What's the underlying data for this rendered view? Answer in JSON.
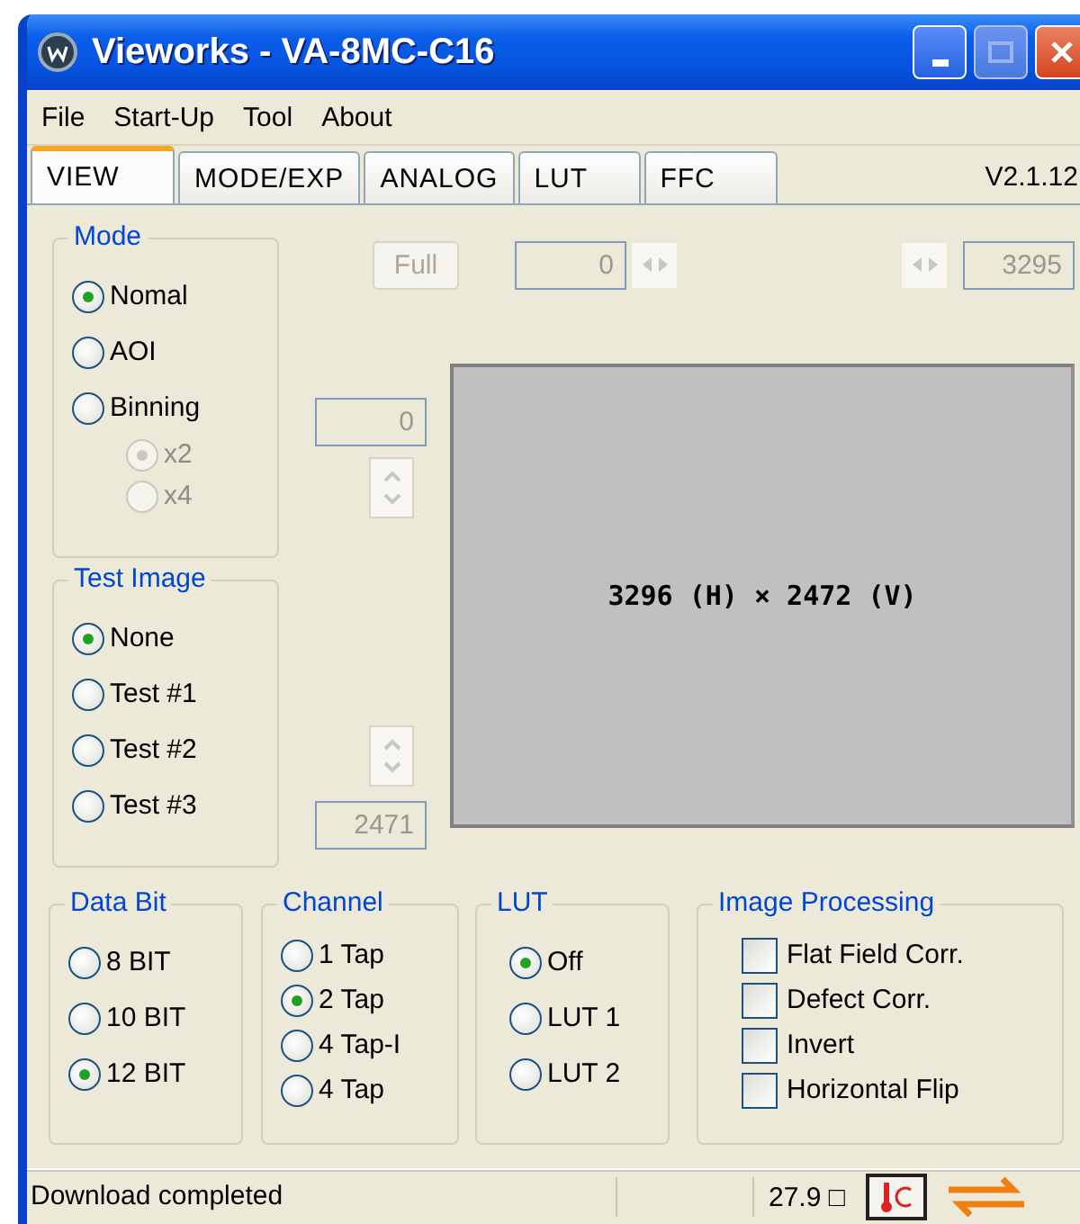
{
  "window": {
    "title": "Vieworks - VA-8MC-C16"
  },
  "menu": [
    "File",
    "Start-Up",
    "Tool",
    "About"
  ],
  "tabs": [
    {
      "label": "VIEW",
      "selected": true
    },
    {
      "label": "MODE/EXP",
      "selected": false
    },
    {
      "label": "ANALOG",
      "selected": false
    },
    {
      "label": "LUT",
      "selected": false
    },
    {
      "label": "FFC",
      "selected": false
    }
  ],
  "version": "V2.1.12",
  "mode": {
    "title": "Mode",
    "options": [
      {
        "label": "Nomal",
        "selected": true
      },
      {
        "label": "AOI",
        "selected": false
      },
      {
        "label": "Binning",
        "selected": false
      }
    ],
    "binning": {
      "disabled": true,
      "options": [
        {
          "label": "x2",
          "selected": true
        },
        {
          "label": "x4",
          "selected": false
        }
      ]
    }
  },
  "test_image": {
    "title": "Test Image",
    "options": [
      {
        "label": "None",
        "selected": true
      },
      {
        "label": "Test #1",
        "selected": false
      },
      {
        "label": "Test #2",
        "selected": false
      },
      {
        "label": "Test #3",
        "selected": false
      }
    ]
  },
  "roi": {
    "disabled": true,
    "full_button": "Full",
    "x_start": "0",
    "x_end": "3295",
    "y_start": "0",
    "y_end": "2471",
    "image_size": "3296 (H) × 2472 (V)"
  },
  "settings": [
    {
      "title": "Data Bit",
      "kind": "radio",
      "options": [
        {
          "label": "8 BIT",
          "selected": false
        },
        {
          "label": "10 BIT",
          "selected": false
        },
        {
          "label": "12 BIT",
          "selected": true
        }
      ]
    },
    {
      "title": "Channel",
      "kind": "radio",
      "options": [
        {
          "label": "1 Tap",
          "selected": false
        },
        {
          "label": "2 Tap",
          "selected": true
        },
        {
          "label": "4 Tap-I",
          "selected": false
        },
        {
          "label": "4 Tap",
          "selected": false
        }
      ]
    },
    {
      "title": "LUT",
      "kind": "radio",
      "options": [
        {
          "label": "Off",
          "selected": true
        },
        {
          "label": "LUT 1",
          "selected": false
        },
        {
          "label": "LUT 2",
          "selected": false
        }
      ]
    },
    {
      "title": "Image Processing",
      "kind": "checkbox",
      "options": [
        {
          "label": "Flat Field Corr.",
          "checked": false
        },
        {
          "label": "Defect Corr.",
          "checked": false
        },
        {
          "label": "Invert",
          "checked": false
        },
        {
          "label": "Horizontal Flip",
          "checked": false
        }
      ]
    }
  ],
  "status_bar": {
    "message": "Download completed",
    "temperature": "27.9 □"
  }
}
